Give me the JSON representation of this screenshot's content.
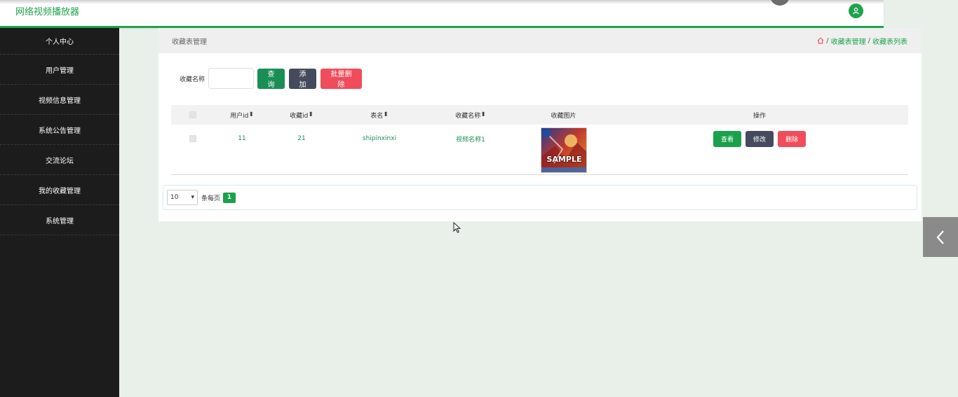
{
  "header": {
    "brand": "网络视频播放器"
  },
  "sidebar": {
    "items": [
      {
        "label": "个人中心"
      },
      {
        "label": "用户管理"
      },
      {
        "label": "视频信息管理"
      },
      {
        "label": "系统公告管理"
      },
      {
        "label": "交流论坛"
      },
      {
        "label": "我的收藏管理"
      },
      {
        "label": "系统管理"
      }
    ]
  },
  "panel": {
    "title": "收藏表管理",
    "breadcrumb": [
      "收藏表管理",
      "收藏表列表"
    ],
    "breadcrumb_sep": "/"
  },
  "search": {
    "label": "收藏名称",
    "value": "",
    "query_label": "查询",
    "add_label": "添加",
    "batch_delete_label": "批量删除"
  },
  "table": {
    "headers": [
      "用户id",
      "收藏id",
      "表名",
      "收藏名称",
      "收藏图片",
      "操作"
    ],
    "rows": [
      {
        "user_id": "11",
        "fav_id": "21",
        "table_name": "shipinxinxi",
        "fav_name": "视频名称1",
        "image_text": "SAMPLE",
        "view_label": "查看",
        "edit_label": "修改",
        "delete_label": "删除"
      }
    ]
  },
  "pagination": {
    "page_size": "10",
    "per_page_label": "条每页",
    "current_page": "1"
  },
  "colors": {
    "accent": "#1ea34a",
    "sidebar_bg": "#1c1c1c",
    "danger": "#f04c5b",
    "neutral_btn": "#454a5c"
  }
}
